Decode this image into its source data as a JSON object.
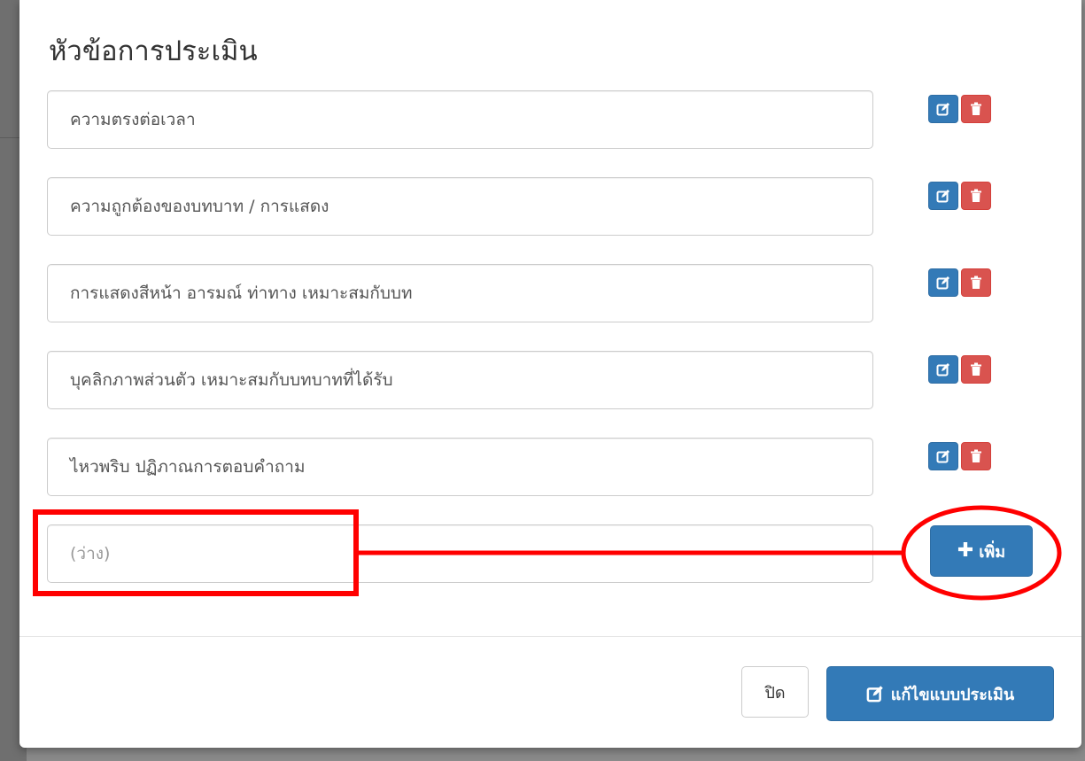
{
  "modal": {
    "section_title": "หัวข้อการประเมิน",
    "criteria": [
      {
        "text": "ความตรงต่อเวลา"
      },
      {
        "text": "ความถูกต้องของบทบาท / การแสดง"
      },
      {
        "text": "การแสดงสีหน้า อารมณ์ ท่าทาง เหมาะสมกับบท"
      },
      {
        "text": "บุคลิกภาพส่วนตัว เหมาะสมกับบทบาทที่ได้รับ"
      },
      {
        "text": "ไหวพริบ ปฏิภาณการตอบคำถาม"
      }
    ],
    "new_item": {
      "placeholder": "(ว่าง)",
      "add_label": "เพิ่ม",
      "add_icon": "plus-icon"
    },
    "row_actions": {
      "edit_icon": "edit-icon",
      "delete_icon": "trash-icon"
    },
    "footer": {
      "close_label": "ปิด",
      "save_label": "แก้ไขแบบประเมิน",
      "save_icon": "edit-icon"
    }
  },
  "colors": {
    "primary": "#337ab7",
    "danger": "#d9534f",
    "annotation": "#ff0000"
  }
}
